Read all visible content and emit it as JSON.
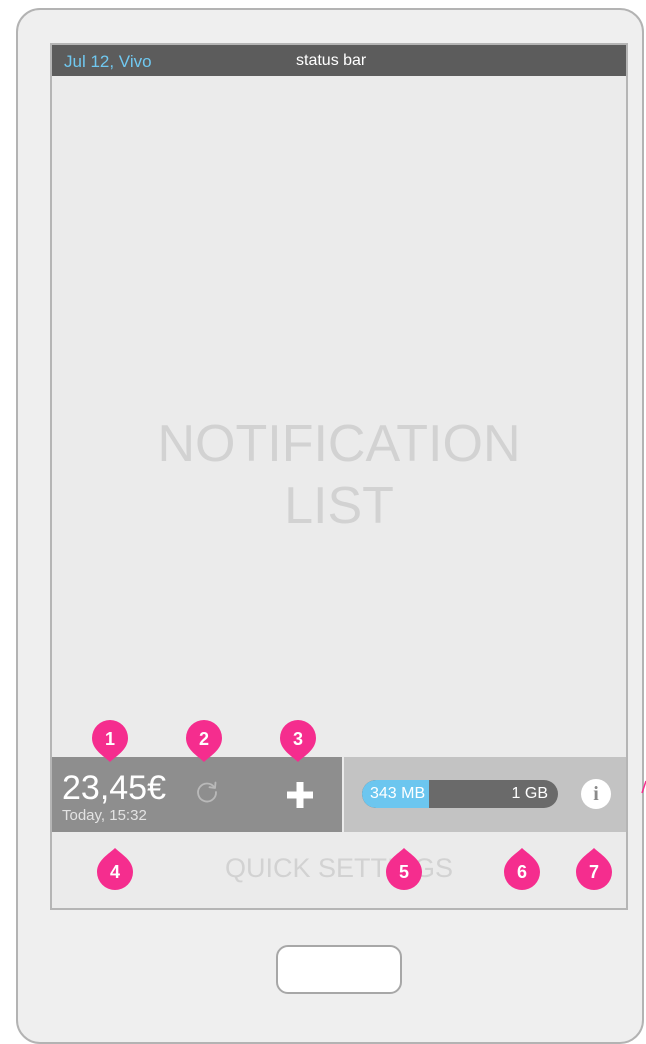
{
  "status_bar": {
    "left_text": "Jul 12, Vivo",
    "center_text": "status bar"
  },
  "notification_list": {
    "line1": "NOTIFICATION",
    "line2": "LIST"
  },
  "quick_settings": {
    "label": "QUICK SETTINGS"
  },
  "balance_widget": {
    "amount": "23,45€",
    "updated": "Today, 15:32",
    "refresh_icon": "refresh-icon",
    "add_icon": "plus-icon"
  },
  "data_widget": {
    "used": "343 MB",
    "total": "1 GB",
    "used_fraction": 0.34,
    "info_label": "i"
  },
  "annotations": [
    "1",
    "2",
    "3",
    "4",
    "5",
    "6",
    "7"
  ],
  "colors": {
    "accent": "#6cc6ef",
    "marker": "#f52d8e",
    "status_bar": "#5c5c5c"
  }
}
